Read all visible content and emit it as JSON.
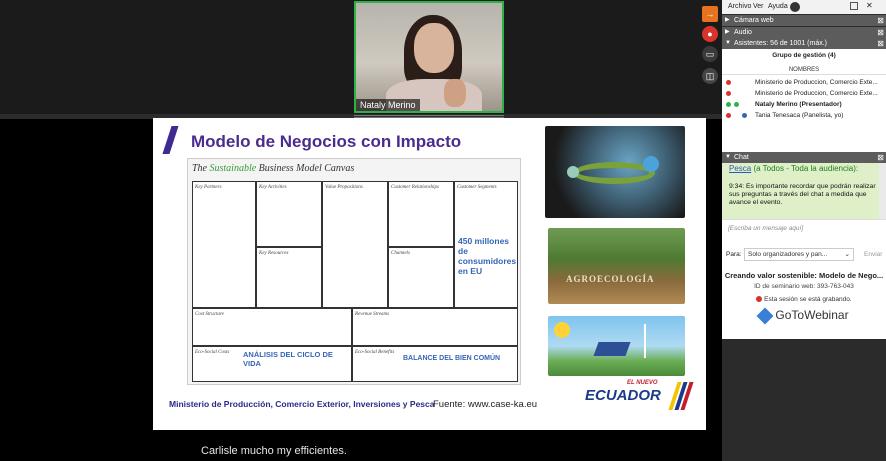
{
  "camera": {
    "name": "Nataly Merino"
  },
  "slide": {
    "title": "Modelo de Negocios con Impacto",
    "canvas_title_pre": "The",
    "canvas_title_green": "Sustainable",
    "canvas_title_post": "Business Model Canvas",
    "cells": {
      "key_partners": "Key Partners",
      "key_activities": "Key Activities",
      "value_propositions": "Value Propositions",
      "customer_relationships": "Customer Relationships",
      "customer_segments": "Customer Segments",
      "key_resources": "Key Resources",
      "channels": "Channels",
      "cost_structure": "Cost Structure",
      "revenue_streams": "Revenue Streams",
      "eco_social_costs": "Eco-Social Costs",
      "eco_social_benefits": "Eco-Social Benefits"
    },
    "highlight_segments": "450 millones de consumidores en EU",
    "highlight_costs": "ANÁLISIS DEL CICLO DE VIDA",
    "highlight_benefits": "BALANCE DEL BIEN COMÚN",
    "footer_left": "Ministerio de Producción, Comercio Exterior, Inversiones y Pesca",
    "footer_right": "Fuente: www.case-ka.eu",
    "agro_label": "AGROECOLOGÍA",
    "logo_small": "EL NUEVO",
    "logo_big": "ECUADOR"
  },
  "caption": "Carlisle mucho my efficientes.",
  "menu": {
    "archivo": "Archivo",
    "ver": "Ver",
    "ayuda": "Ayuda"
  },
  "panels": {
    "camara": "Cámara web",
    "audio": "Audio",
    "asistentes": "Asistentes: 56 de 1001 (máx.)",
    "chat": "Chat"
  },
  "attendees": {
    "group": "Grupo de gestión (4)",
    "column": "NOMBRES",
    "rows": [
      "Ministerio de Produccion, Comercio Exte...",
      "Ministerio de Produccion, Comercio Exte...",
      "Nataly Merino (Presentador)",
      "Tania Tenesaca (Panelista, yo)"
    ]
  },
  "chat": {
    "sender": "Pesca",
    "audience": " (a Todos - Toda la audiencia):",
    "time": "9:34:",
    "message": "Es importante recordar que podrán realizar sus preguntas a través del chat a medida que avance el evento.",
    "placeholder": "[Escriba un mensaje aquí]",
    "to_label": "Para:",
    "to_value": "Solo organizadores y pan...",
    "send": "Enviar"
  },
  "webinar": {
    "title": "Creando valor sostenible: Modelo de Nego...",
    "id_line": "ID de seminario web: 393-763-043",
    "recording": "Esta sesión se está grabando.",
    "brand": "GoToWebinar"
  },
  "colors": {
    "accent_green": "#2db24a",
    "title_purple": "#4b2c8e",
    "highlight_blue": "#3566b6"
  }
}
